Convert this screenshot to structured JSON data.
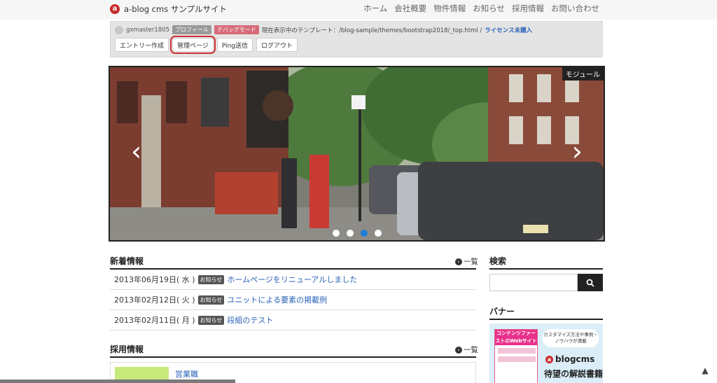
{
  "header": {
    "site_title": "a-blog cms サンプルサイト",
    "nav": [
      "ホーム",
      "会社概要",
      "物件情報",
      "お知らせ",
      "採用情報",
      "お問い合わせ"
    ]
  },
  "admin": {
    "username": "gxmaster1805",
    "profile_label": "プロフィール",
    "debug_label": "デバッグモード",
    "template_text": "現在表示中のテンプレート：/blog-sample/themes/bootstrap2018/_top.html /",
    "license_text": "ライセンス未購入",
    "buttons": [
      "エントリー作成",
      "管理ページ",
      "Ping送信",
      "ログアウト"
    ]
  },
  "carousel": {
    "module_label": "モジュール",
    "prev": "‹",
    "next": "›",
    "active_index": 2,
    "slide_count": 4
  },
  "news": {
    "title": "新着情報",
    "more_label": "一覧",
    "items": [
      {
        "date": "2013年06月19日( 水 )",
        "badge": "お知らせ",
        "title": "ホームページをリニューアルしました"
      },
      {
        "date": "2013年02月12日( 火 )",
        "badge": "お知らせ",
        "title": "ユニットによる要素の掲載例"
      },
      {
        "date": "2013年02月11日( 月 )",
        "badge": "お知らせ",
        "title": "段組のテスト"
      }
    ]
  },
  "recruit": {
    "title": "採用情報",
    "more_label": "一覧",
    "first_item": "営業職"
  },
  "sidebar": {
    "search_title": "検索",
    "search_placeholder": "",
    "banner_title": "バナー",
    "banner": {
      "book_title": "コンテンツファーストのWebサイト運用",
      "bubble": "カスタマイズ方法や事例・ノウハウが満載",
      "logo_text": "blogcms",
      "headline": "待望の解説書籍"
    }
  },
  "colors": {
    "accent_link": "#2a63b8",
    "active_dot": "#1c7fd6",
    "debug_pill": "#d66b7a",
    "logo_red": "#c82a2a"
  }
}
